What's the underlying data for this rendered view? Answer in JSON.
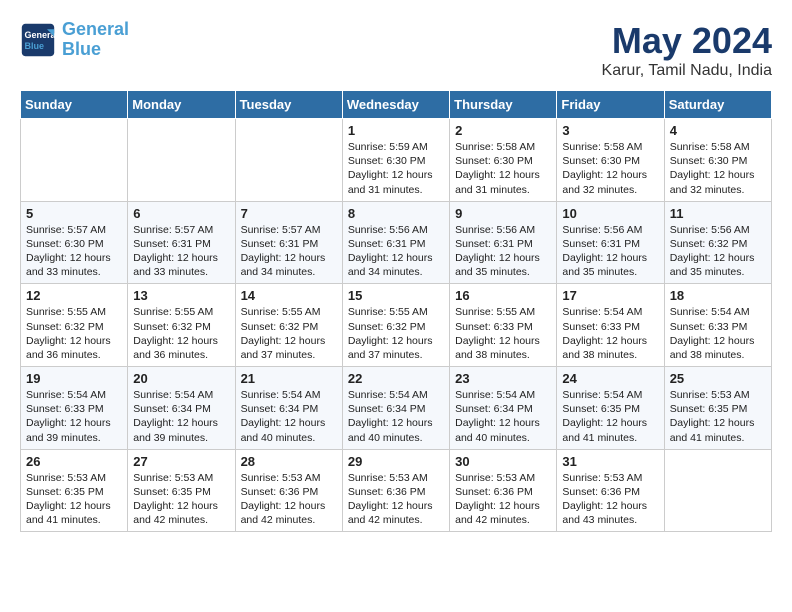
{
  "header": {
    "logo_line1": "General",
    "logo_line2": "Blue",
    "month_title": "May 2024",
    "location": "Karur, Tamil Nadu, India"
  },
  "weekdays": [
    "Sunday",
    "Monday",
    "Tuesday",
    "Wednesday",
    "Thursday",
    "Friday",
    "Saturday"
  ],
  "weeks": [
    [
      {
        "day": "",
        "info": ""
      },
      {
        "day": "",
        "info": ""
      },
      {
        "day": "",
        "info": ""
      },
      {
        "day": "1",
        "info": "Sunrise: 5:59 AM\nSunset: 6:30 PM\nDaylight: 12 hours\nand 31 minutes."
      },
      {
        "day": "2",
        "info": "Sunrise: 5:58 AM\nSunset: 6:30 PM\nDaylight: 12 hours\nand 31 minutes."
      },
      {
        "day": "3",
        "info": "Sunrise: 5:58 AM\nSunset: 6:30 PM\nDaylight: 12 hours\nand 32 minutes."
      },
      {
        "day": "4",
        "info": "Sunrise: 5:58 AM\nSunset: 6:30 PM\nDaylight: 12 hours\nand 32 minutes."
      }
    ],
    [
      {
        "day": "5",
        "info": "Sunrise: 5:57 AM\nSunset: 6:30 PM\nDaylight: 12 hours\nand 33 minutes."
      },
      {
        "day": "6",
        "info": "Sunrise: 5:57 AM\nSunset: 6:31 PM\nDaylight: 12 hours\nand 33 minutes."
      },
      {
        "day": "7",
        "info": "Sunrise: 5:57 AM\nSunset: 6:31 PM\nDaylight: 12 hours\nand 34 minutes."
      },
      {
        "day": "8",
        "info": "Sunrise: 5:56 AM\nSunset: 6:31 PM\nDaylight: 12 hours\nand 34 minutes."
      },
      {
        "day": "9",
        "info": "Sunrise: 5:56 AM\nSunset: 6:31 PM\nDaylight: 12 hours\nand 35 minutes."
      },
      {
        "day": "10",
        "info": "Sunrise: 5:56 AM\nSunset: 6:31 PM\nDaylight: 12 hours\nand 35 minutes."
      },
      {
        "day": "11",
        "info": "Sunrise: 5:56 AM\nSunset: 6:32 PM\nDaylight: 12 hours\nand 35 minutes."
      }
    ],
    [
      {
        "day": "12",
        "info": "Sunrise: 5:55 AM\nSunset: 6:32 PM\nDaylight: 12 hours\nand 36 minutes."
      },
      {
        "day": "13",
        "info": "Sunrise: 5:55 AM\nSunset: 6:32 PM\nDaylight: 12 hours\nand 36 minutes."
      },
      {
        "day": "14",
        "info": "Sunrise: 5:55 AM\nSunset: 6:32 PM\nDaylight: 12 hours\nand 37 minutes."
      },
      {
        "day": "15",
        "info": "Sunrise: 5:55 AM\nSunset: 6:32 PM\nDaylight: 12 hours\nand 37 minutes."
      },
      {
        "day": "16",
        "info": "Sunrise: 5:55 AM\nSunset: 6:33 PM\nDaylight: 12 hours\nand 38 minutes."
      },
      {
        "day": "17",
        "info": "Sunrise: 5:54 AM\nSunset: 6:33 PM\nDaylight: 12 hours\nand 38 minutes."
      },
      {
        "day": "18",
        "info": "Sunrise: 5:54 AM\nSunset: 6:33 PM\nDaylight: 12 hours\nand 38 minutes."
      }
    ],
    [
      {
        "day": "19",
        "info": "Sunrise: 5:54 AM\nSunset: 6:33 PM\nDaylight: 12 hours\nand 39 minutes."
      },
      {
        "day": "20",
        "info": "Sunrise: 5:54 AM\nSunset: 6:34 PM\nDaylight: 12 hours\nand 39 minutes."
      },
      {
        "day": "21",
        "info": "Sunrise: 5:54 AM\nSunset: 6:34 PM\nDaylight: 12 hours\nand 40 minutes."
      },
      {
        "day": "22",
        "info": "Sunrise: 5:54 AM\nSunset: 6:34 PM\nDaylight: 12 hours\nand 40 minutes."
      },
      {
        "day": "23",
        "info": "Sunrise: 5:54 AM\nSunset: 6:34 PM\nDaylight: 12 hours\nand 40 minutes."
      },
      {
        "day": "24",
        "info": "Sunrise: 5:54 AM\nSunset: 6:35 PM\nDaylight: 12 hours\nand 41 minutes."
      },
      {
        "day": "25",
        "info": "Sunrise: 5:53 AM\nSunset: 6:35 PM\nDaylight: 12 hours\nand 41 minutes."
      }
    ],
    [
      {
        "day": "26",
        "info": "Sunrise: 5:53 AM\nSunset: 6:35 PM\nDaylight: 12 hours\nand 41 minutes."
      },
      {
        "day": "27",
        "info": "Sunrise: 5:53 AM\nSunset: 6:35 PM\nDaylight: 12 hours\nand 42 minutes."
      },
      {
        "day": "28",
        "info": "Sunrise: 5:53 AM\nSunset: 6:36 PM\nDaylight: 12 hours\nand 42 minutes."
      },
      {
        "day": "29",
        "info": "Sunrise: 5:53 AM\nSunset: 6:36 PM\nDaylight: 12 hours\nand 42 minutes."
      },
      {
        "day": "30",
        "info": "Sunrise: 5:53 AM\nSunset: 6:36 PM\nDaylight: 12 hours\nand 42 minutes."
      },
      {
        "day": "31",
        "info": "Sunrise: 5:53 AM\nSunset: 6:36 PM\nDaylight: 12 hours\nand 43 minutes."
      },
      {
        "day": "",
        "info": ""
      }
    ]
  ]
}
